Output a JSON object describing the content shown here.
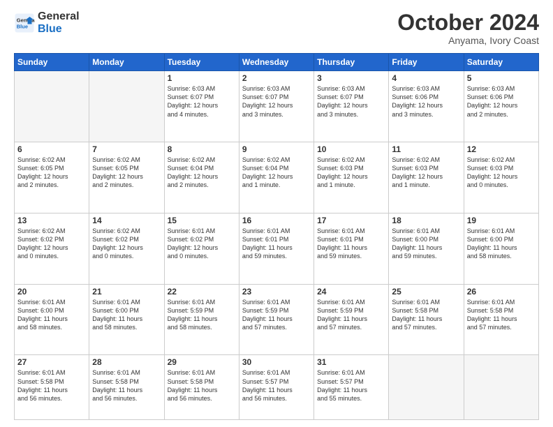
{
  "logo": {
    "line1": "General",
    "line2": "Blue"
  },
  "header": {
    "month": "October 2024",
    "location": "Anyama, Ivory Coast"
  },
  "weekdays": [
    "Sunday",
    "Monday",
    "Tuesday",
    "Wednesday",
    "Thursday",
    "Friday",
    "Saturday"
  ],
  "weeks": [
    [
      {
        "day": "",
        "info": ""
      },
      {
        "day": "",
        "info": ""
      },
      {
        "day": "1",
        "info": "Sunrise: 6:03 AM\nSunset: 6:07 PM\nDaylight: 12 hours\nand 4 minutes."
      },
      {
        "day": "2",
        "info": "Sunrise: 6:03 AM\nSunset: 6:07 PM\nDaylight: 12 hours\nand 3 minutes."
      },
      {
        "day": "3",
        "info": "Sunrise: 6:03 AM\nSunset: 6:07 PM\nDaylight: 12 hours\nand 3 minutes."
      },
      {
        "day": "4",
        "info": "Sunrise: 6:03 AM\nSunset: 6:06 PM\nDaylight: 12 hours\nand 3 minutes."
      },
      {
        "day": "5",
        "info": "Sunrise: 6:03 AM\nSunset: 6:06 PM\nDaylight: 12 hours\nand 2 minutes."
      }
    ],
    [
      {
        "day": "6",
        "info": "Sunrise: 6:02 AM\nSunset: 6:05 PM\nDaylight: 12 hours\nand 2 minutes."
      },
      {
        "day": "7",
        "info": "Sunrise: 6:02 AM\nSunset: 6:05 PM\nDaylight: 12 hours\nand 2 minutes."
      },
      {
        "day": "8",
        "info": "Sunrise: 6:02 AM\nSunset: 6:04 PM\nDaylight: 12 hours\nand 2 minutes."
      },
      {
        "day": "9",
        "info": "Sunrise: 6:02 AM\nSunset: 6:04 PM\nDaylight: 12 hours\nand 1 minute."
      },
      {
        "day": "10",
        "info": "Sunrise: 6:02 AM\nSunset: 6:03 PM\nDaylight: 12 hours\nand 1 minute."
      },
      {
        "day": "11",
        "info": "Sunrise: 6:02 AM\nSunset: 6:03 PM\nDaylight: 12 hours\nand 1 minute."
      },
      {
        "day": "12",
        "info": "Sunrise: 6:02 AM\nSunset: 6:03 PM\nDaylight: 12 hours\nand 0 minutes."
      }
    ],
    [
      {
        "day": "13",
        "info": "Sunrise: 6:02 AM\nSunset: 6:02 PM\nDaylight: 12 hours\nand 0 minutes."
      },
      {
        "day": "14",
        "info": "Sunrise: 6:02 AM\nSunset: 6:02 PM\nDaylight: 12 hours\nand 0 minutes."
      },
      {
        "day": "15",
        "info": "Sunrise: 6:01 AM\nSunset: 6:02 PM\nDaylight: 12 hours\nand 0 minutes."
      },
      {
        "day": "16",
        "info": "Sunrise: 6:01 AM\nSunset: 6:01 PM\nDaylight: 11 hours\nand 59 minutes."
      },
      {
        "day": "17",
        "info": "Sunrise: 6:01 AM\nSunset: 6:01 PM\nDaylight: 11 hours\nand 59 minutes."
      },
      {
        "day": "18",
        "info": "Sunrise: 6:01 AM\nSunset: 6:00 PM\nDaylight: 11 hours\nand 59 minutes."
      },
      {
        "day": "19",
        "info": "Sunrise: 6:01 AM\nSunset: 6:00 PM\nDaylight: 11 hours\nand 58 minutes."
      }
    ],
    [
      {
        "day": "20",
        "info": "Sunrise: 6:01 AM\nSunset: 6:00 PM\nDaylight: 11 hours\nand 58 minutes."
      },
      {
        "day": "21",
        "info": "Sunrise: 6:01 AM\nSunset: 6:00 PM\nDaylight: 11 hours\nand 58 minutes."
      },
      {
        "day": "22",
        "info": "Sunrise: 6:01 AM\nSunset: 5:59 PM\nDaylight: 11 hours\nand 58 minutes."
      },
      {
        "day": "23",
        "info": "Sunrise: 6:01 AM\nSunset: 5:59 PM\nDaylight: 11 hours\nand 57 minutes."
      },
      {
        "day": "24",
        "info": "Sunrise: 6:01 AM\nSunset: 5:59 PM\nDaylight: 11 hours\nand 57 minutes."
      },
      {
        "day": "25",
        "info": "Sunrise: 6:01 AM\nSunset: 5:58 PM\nDaylight: 11 hours\nand 57 minutes."
      },
      {
        "day": "26",
        "info": "Sunrise: 6:01 AM\nSunset: 5:58 PM\nDaylight: 11 hours\nand 57 minutes."
      }
    ],
    [
      {
        "day": "27",
        "info": "Sunrise: 6:01 AM\nSunset: 5:58 PM\nDaylight: 11 hours\nand 56 minutes."
      },
      {
        "day": "28",
        "info": "Sunrise: 6:01 AM\nSunset: 5:58 PM\nDaylight: 11 hours\nand 56 minutes."
      },
      {
        "day": "29",
        "info": "Sunrise: 6:01 AM\nSunset: 5:58 PM\nDaylight: 11 hours\nand 56 minutes."
      },
      {
        "day": "30",
        "info": "Sunrise: 6:01 AM\nSunset: 5:57 PM\nDaylight: 11 hours\nand 56 minutes."
      },
      {
        "day": "31",
        "info": "Sunrise: 6:01 AM\nSunset: 5:57 PM\nDaylight: 11 hours\nand 55 minutes."
      },
      {
        "day": "",
        "info": ""
      },
      {
        "day": "",
        "info": ""
      }
    ]
  ]
}
